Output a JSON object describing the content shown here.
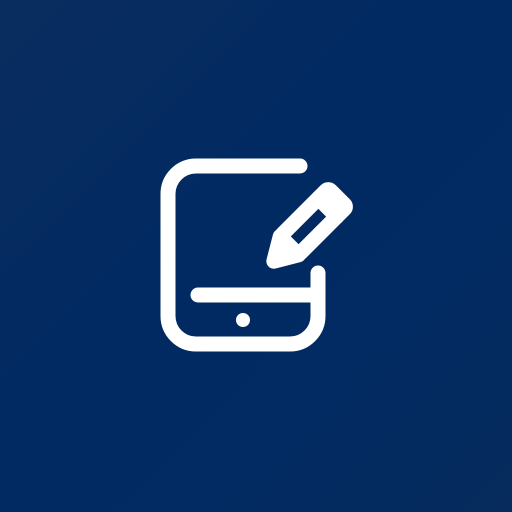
{
  "icon": {
    "name": "tablet-with-pencil-icon",
    "background_color": "#022b63",
    "foreground_color": "#ffffff"
  }
}
